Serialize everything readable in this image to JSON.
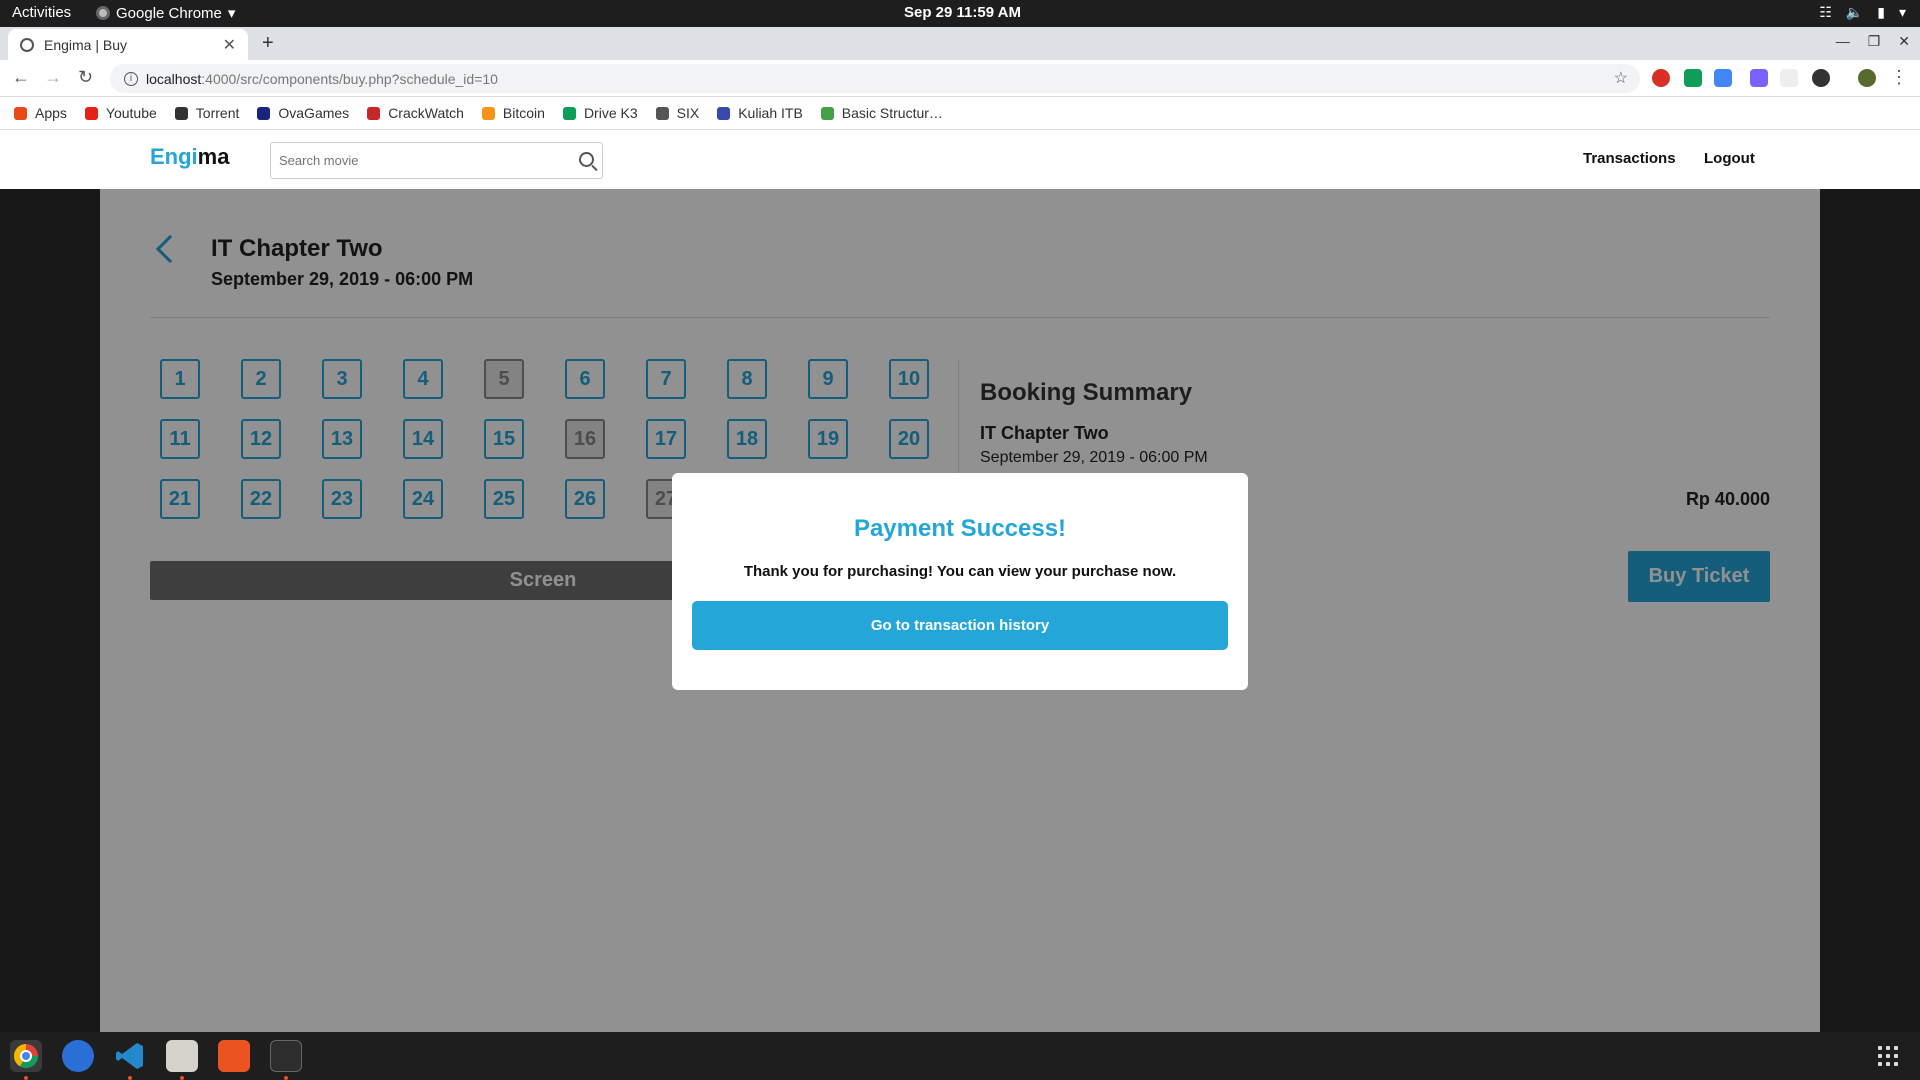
{
  "system": {
    "activities": "Activities",
    "app_name": "Google Chrome",
    "clock": "Sep 29  11:59 AM"
  },
  "browser": {
    "tab_title": "Engima | Buy",
    "url_host": "localhost",
    "url_path": ":4000/src/components/buy.php?schedule_id=10",
    "bookmarks": [
      "Apps",
      "Youtube",
      "Torrent",
      "OvaGames",
      "CrackWatch",
      "Bitcoin",
      "Drive K3",
      "SIX",
      "Kuliah ITB",
      "Basic Structur…"
    ],
    "bookmark_colors": [
      "#e64a19",
      "#e62117",
      "#333333",
      "#1a237e",
      "#c62828",
      "#f7931a",
      "#0f9d58",
      "#555555",
      "#3949ab",
      "#43a047"
    ]
  },
  "site": {
    "logo_part1": "Engi",
    "logo_part2": "ma",
    "search_placeholder": "Search movie",
    "nav": [
      "Transactions",
      "Logout"
    ],
    "accent": "#24a6d8"
  },
  "booking": {
    "title": "IT Chapter Two",
    "datetime": "September 29, 2019 - 06:00 PM",
    "seats": [
      "1",
      "2",
      "3",
      "4",
      "5",
      "6",
      "7",
      "8",
      "9",
      "10",
      "11",
      "12",
      "13",
      "14",
      "15",
      "16",
      "17",
      "18",
      "19",
      "20",
      "21",
      "22",
      "23",
      "24",
      "25",
      "26",
      "27"
    ],
    "taken_seats": [
      "5",
      "16",
      "27"
    ],
    "screen_label": "Screen",
    "summary_title": "Booking Summary",
    "summary_movie": "IT Chapter Two",
    "summary_datetime": "September 29, 2019 - 06:00 PM",
    "price": "Rp 40.000",
    "buy_label": "Buy Ticket"
  },
  "modal": {
    "title": "Payment Success!",
    "message": "Thank you for purchasing! You can view your purchase now.",
    "button": "Go to transaction history"
  }
}
